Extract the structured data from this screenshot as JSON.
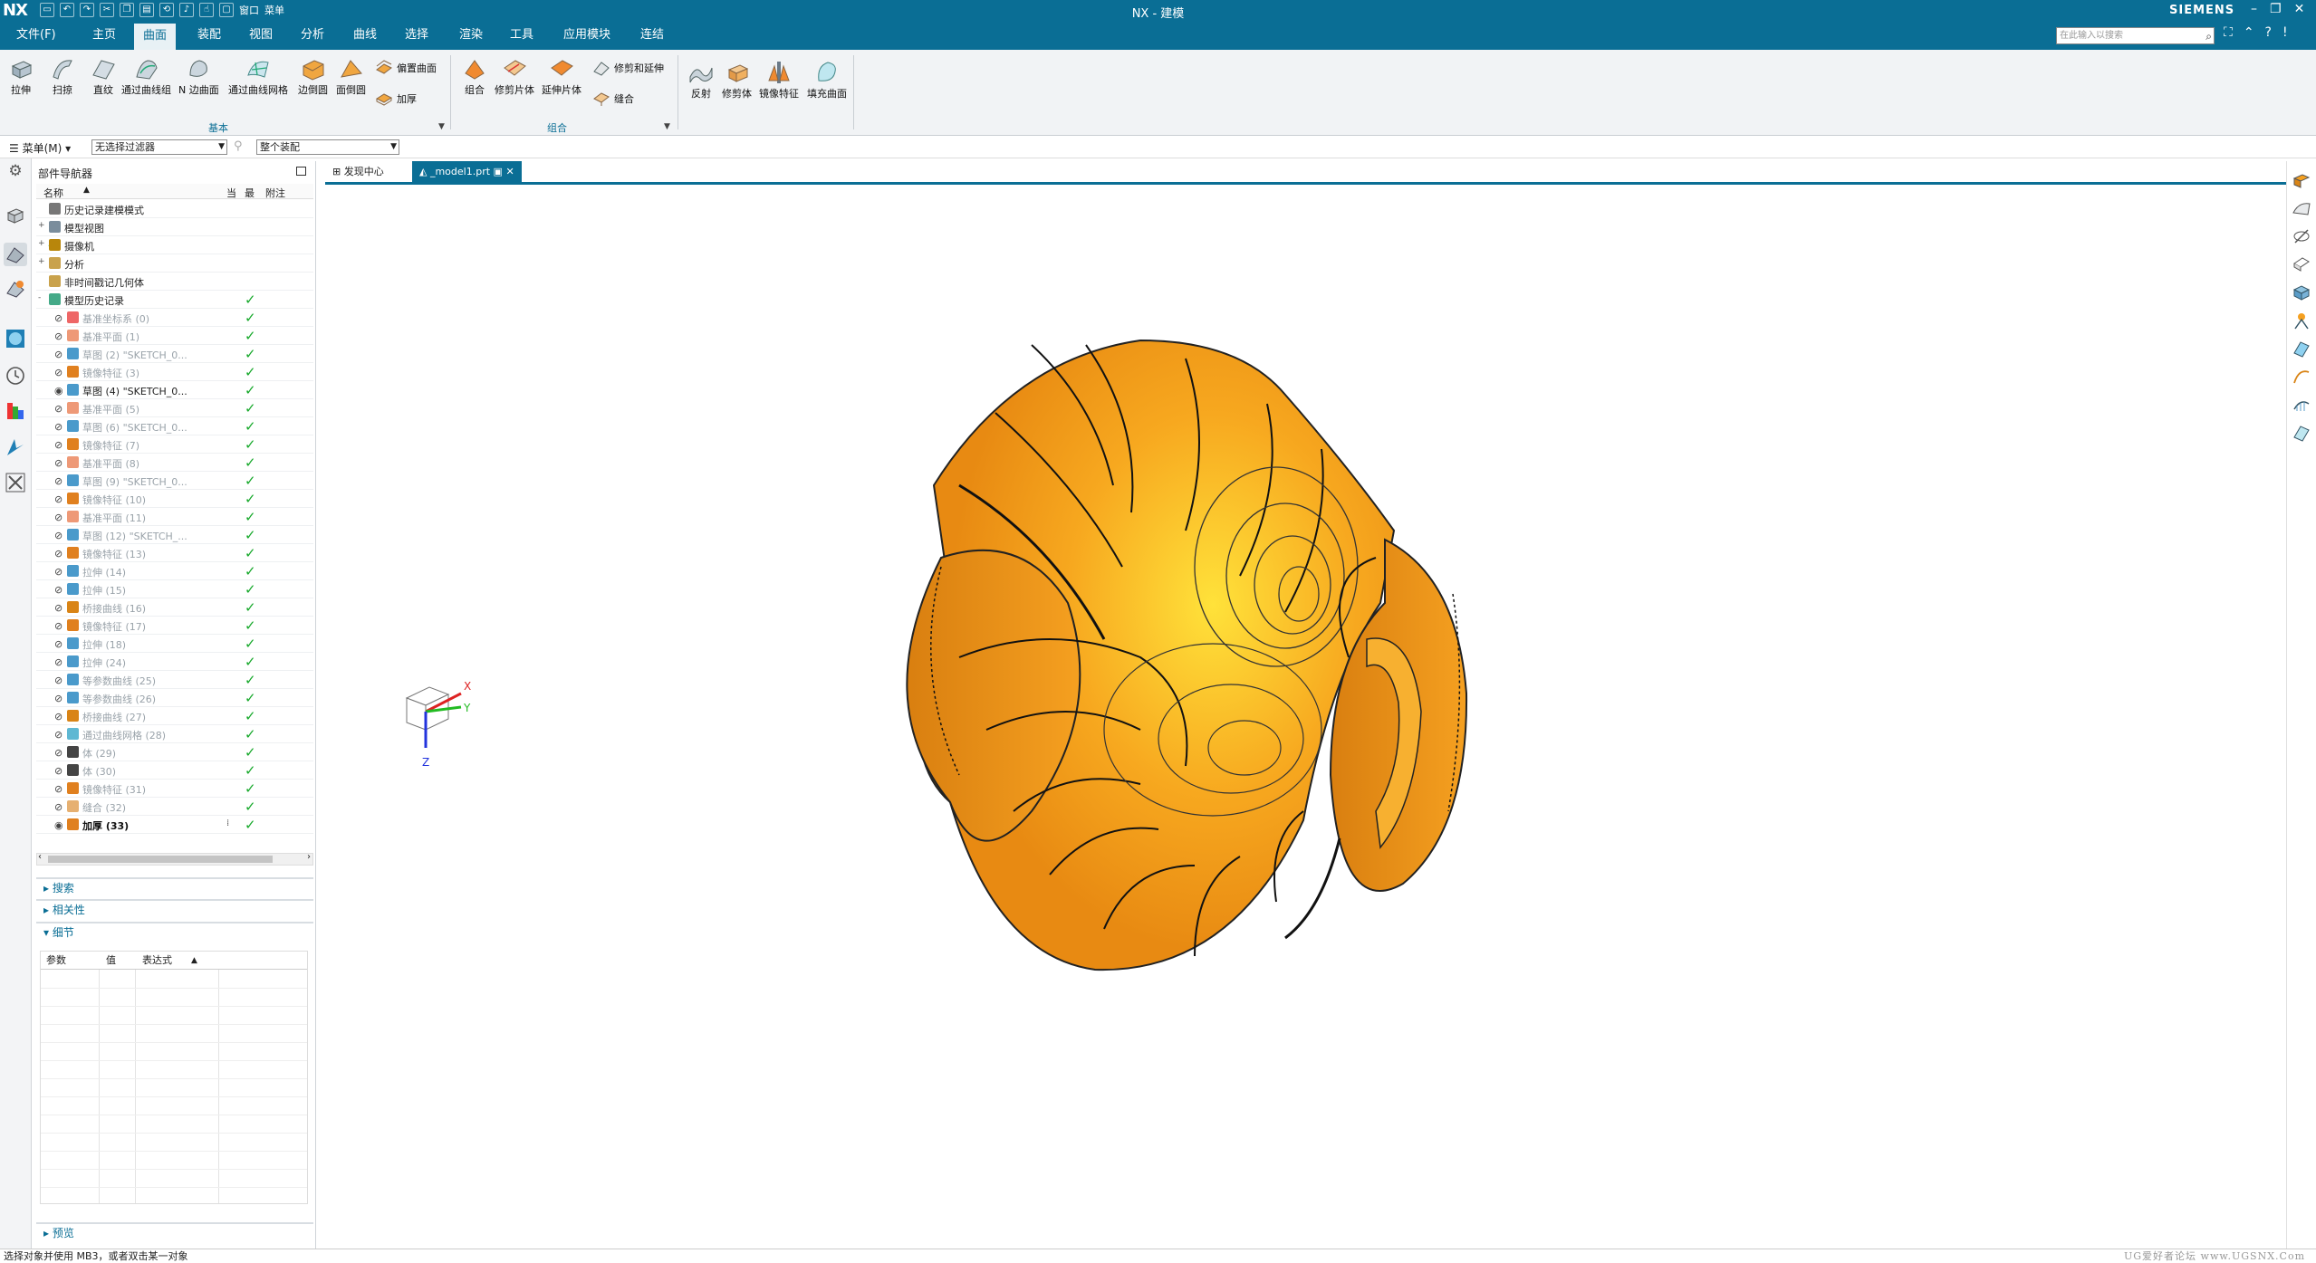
{
  "titlebar": {
    "logo": "NX",
    "title": "NX - 建模",
    "brand": "SIEMENS",
    "quick_access": {
      "window_label": "窗口",
      "menu_label": "菜单"
    }
  },
  "menubar": {
    "tabs": [
      "文件(F)",
      "主页",
      "曲面",
      "装配",
      "视图",
      "分析",
      "曲线",
      "选择",
      "渲染",
      "工具",
      "应用模块",
      "连结"
    ],
    "active_tab": "曲面",
    "search_placeholder": "在此输入以搜索"
  },
  "ribbon": {
    "groups": [
      {
        "label": "基本",
        "big": [
          "拉伸",
          "扫掠",
          "直纹",
          "通过曲线组",
          "N 边曲面",
          "通过曲线网格",
          "边倒圆",
          "面倒圆"
        ],
        "small": [
          "偏置曲面",
          "加厚"
        ]
      },
      {
        "label": "组合",
        "big": [
          "组合",
          "修剪片体",
          "延伸片体"
        ],
        "small": [
          "修剪和延伸",
          "缝合"
        ]
      },
      {
        "label": "",
        "big": [
          "反射",
          "修剪体",
          "镜像特征",
          "填充曲面"
        ],
        "small": []
      }
    ]
  },
  "selbar": {
    "menu_label": "菜单(M)",
    "filter_value": "无选择过滤器",
    "scope_value": "整个装配"
  },
  "navigator": {
    "title": "部件导航器",
    "columns": [
      "名称",
      "当",
      "最",
      "附注"
    ],
    "rows": [
      {
        "label": "历史记录建模模式",
        "indent": 0,
        "icon": "clock",
        "eye": "",
        "check": false,
        "style": "normal",
        "exp": ""
      },
      {
        "label": "模型视图",
        "indent": 0,
        "icon": "view",
        "eye": "",
        "check": false,
        "style": "normal",
        "exp": "+"
      },
      {
        "label": "摄像机",
        "indent": 0,
        "icon": "camera",
        "eye": "",
        "check": false,
        "style": "normal",
        "exp": "+",
        "tick": true
      },
      {
        "label": "分析",
        "indent": 0,
        "icon": "folder",
        "eye": "",
        "check": false,
        "style": "normal",
        "exp": "+"
      },
      {
        "label": "非时间戳记几何体",
        "indent": 0,
        "icon": "folder",
        "eye": "",
        "check": false,
        "style": "normal",
        "exp": ""
      },
      {
        "label": "模型历史记录",
        "indent": 0,
        "icon": "history",
        "eye": "",
        "check": true,
        "style": "normal",
        "exp": "-"
      },
      {
        "label": "基准坐标系 (0)",
        "indent": 1,
        "icon": "csys",
        "eye": "hidden",
        "check": true,
        "style": "dim"
      },
      {
        "label": "基准平面 (1)",
        "indent": 1,
        "icon": "plane",
        "eye": "hidden",
        "check": true,
        "style": "dim"
      },
      {
        "label": "草图 (2) \"SKETCH_0...",
        "indent": 1,
        "icon": "sketch",
        "eye": "hidden",
        "check": true,
        "style": "dim"
      },
      {
        "label": "镜像特征 (3)",
        "indent": 1,
        "icon": "mirror",
        "eye": "hidden",
        "check": true,
        "style": "dim"
      },
      {
        "label": "草图 (4) \"SKETCH_0...",
        "indent": 1,
        "icon": "sketch",
        "eye": "visible",
        "check": true,
        "style": "normal"
      },
      {
        "label": "基准平面 (5)",
        "indent": 1,
        "icon": "plane",
        "eye": "hidden",
        "check": true,
        "style": "dim"
      },
      {
        "label": "草图 (6) \"SKETCH_0...",
        "indent": 1,
        "icon": "sketch",
        "eye": "hidden",
        "check": true,
        "style": "dim"
      },
      {
        "label": "镜像特征 (7)",
        "indent": 1,
        "icon": "mirror",
        "eye": "hidden",
        "check": true,
        "style": "dim"
      },
      {
        "label": "基准平面 (8)",
        "indent": 1,
        "icon": "plane",
        "eye": "hidden",
        "check": true,
        "style": "dim"
      },
      {
        "label": "草图 (9) \"SKETCH_0...",
        "indent": 1,
        "icon": "sketch",
        "eye": "hidden",
        "check": true,
        "style": "dim"
      },
      {
        "label": "镜像特征 (10)",
        "indent": 1,
        "icon": "mirror",
        "eye": "hidden",
        "check": true,
        "style": "dim"
      },
      {
        "label": "基准平面 (11)",
        "indent": 1,
        "icon": "plane",
        "eye": "hidden",
        "check": true,
        "style": "dim"
      },
      {
        "label": "草图 (12) \"SKETCH_...",
        "indent": 1,
        "icon": "sketch",
        "eye": "hidden",
        "check": true,
        "style": "dim"
      },
      {
        "label": "镜像特征 (13)",
        "indent": 1,
        "icon": "mirror",
        "eye": "hidden",
        "check": true,
        "style": "dim"
      },
      {
        "label": "拉伸 (14)",
        "indent": 1,
        "icon": "extrude",
        "eye": "hidden",
        "check": true,
        "style": "dim"
      },
      {
        "label": "拉伸 (15)",
        "indent": 1,
        "icon": "extrude",
        "eye": "hidden",
        "check": true,
        "style": "dim"
      },
      {
        "label": "桥接曲线 (16)",
        "indent": 1,
        "icon": "curve",
        "eye": "hidden",
        "check": true,
        "style": "dim"
      },
      {
        "label": "镜像特征 (17)",
        "indent": 1,
        "icon": "mirror",
        "eye": "hidden",
        "check": true,
        "style": "dim"
      },
      {
        "label": "拉伸 (18)",
        "indent": 1,
        "icon": "extrude",
        "eye": "hidden",
        "check": true,
        "style": "dim"
      },
      {
        "label": "拉伸 (24)",
        "indent": 1,
        "icon": "extrude",
        "eye": "hidden",
        "check": true,
        "style": "dim"
      },
      {
        "label": "等参数曲线 (25)",
        "indent": 1,
        "icon": "isocurve",
        "eye": "hidden",
        "check": true,
        "style": "dim"
      },
      {
        "label": "等参数曲线 (26)",
        "indent": 1,
        "icon": "isocurve",
        "eye": "hidden",
        "check": true,
        "style": "dim"
      },
      {
        "label": "桥接曲线 (27)",
        "indent": 1,
        "icon": "curve",
        "eye": "hidden",
        "check": true,
        "style": "dim"
      },
      {
        "label": "通过曲线网格 (28)",
        "indent": 1,
        "icon": "mesh",
        "eye": "hidden",
        "check": true,
        "style": "dim"
      },
      {
        "label": "体 (29)",
        "indent": 1,
        "icon": "body",
        "eye": "hidden",
        "check": true,
        "style": "dim"
      },
      {
        "label": "体 (30)",
        "indent": 1,
        "icon": "body",
        "eye": "hidden",
        "check": true,
        "style": "dim"
      },
      {
        "label": "镜像特征 (31)",
        "indent": 1,
        "icon": "mirror",
        "eye": "hidden",
        "check": true,
        "style": "dim"
      },
      {
        "label": "缝合 (32)",
        "indent": 1,
        "icon": "sew",
        "eye": "hidden",
        "check": true,
        "style": "dim"
      },
      {
        "label": "加厚 (33)",
        "indent": 1,
        "icon": "thicken",
        "eye": "visible",
        "check": true,
        "style": "bold",
        "flag": true
      }
    ],
    "sections": [
      "搜索",
      "相关性",
      "细节",
      "预览"
    ],
    "details_columns": [
      "参数",
      "值",
      "表达式"
    ]
  },
  "tabs": {
    "items": [
      "发现中心",
      "_model1.prt"
    ],
    "active": "_model1.prt"
  },
  "triad": {
    "x": "X",
    "y": "Y",
    "z": "Z"
  },
  "status": {
    "message": "选择对象并使用 MB3，或者双击某一对象",
    "watermark": "UG爱好者论坛 www.UGSNX.Com"
  },
  "colors": {
    "accent": "#0a6e95",
    "model": "#f5a020",
    "check": "#16a82a"
  }
}
